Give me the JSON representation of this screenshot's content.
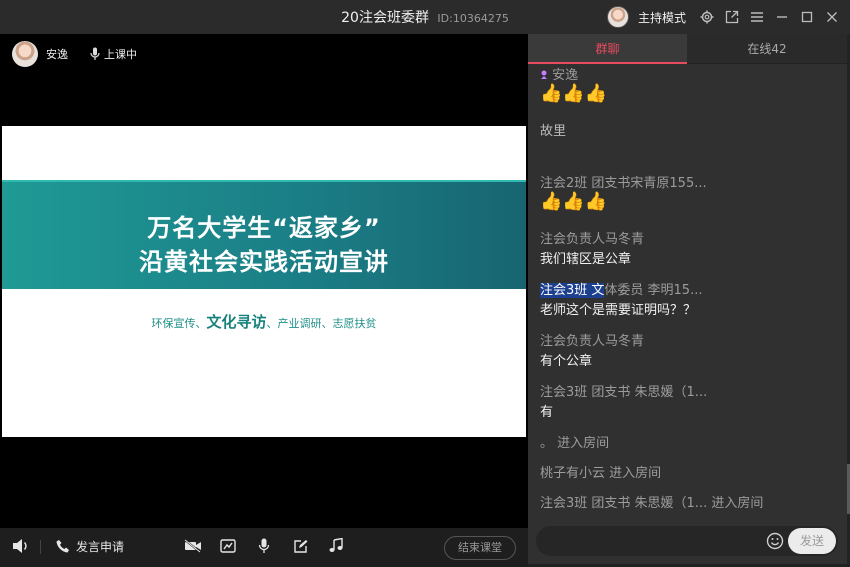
{
  "window": {
    "title": "20注会班委群",
    "id_label": "ID:10364275",
    "mode_label": "主持模式"
  },
  "video": {
    "user_name": "安逸",
    "status": "上课中"
  },
  "slide": {
    "title_line1": "万名大学生“返家乡”",
    "title_line2": "沿黄社会实践活动宣讲",
    "sub_part1": "环保宣传、",
    "sub_big": "文化寻访",
    "sub_part2": "、产业调研、志愿扶贫"
  },
  "bottombar": {
    "speak_request": "发言申请",
    "end_class": "结束课堂"
  },
  "chat": {
    "tabs": [
      {
        "label": "群聊",
        "active": true
      },
      {
        "label": "在线42",
        "active": false
      }
    ],
    "messages": [
      {
        "sender": "安逸",
        "text": "👍👍👍"
      },
      {
        "sender": "故里",
        "text": ""
      },
      {
        "sender": "注会2班 团支书宋青原155...",
        "text": "👍👍👍"
      },
      {
        "sender": "注会负责人马冬青",
        "text": "我们辖区是公章"
      },
      {
        "sender_highlight": "注会3班 文",
        "sender_rest": "体委员 李明15...",
        "text": "老师这个是需要证明吗？？"
      },
      {
        "sender": "注会负责人马冬青",
        "text": "有个公章"
      },
      {
        "sender": "注会3班 团支书 朱思媛（1...",
        "text": "有"
      }
    ],
    "events": [
      "。      进入房间",
      "桃子有小云 进入房间",
      "注会3班 团支书 朱思媛（1... 进入房间"
    ],
    "send_label": "发送"
  },
  "colors": {
    "accent": "#e84a5f",
    "slide_teal": "#1b7f87",
    "highlight": "#1c3f8f"
  }
}
